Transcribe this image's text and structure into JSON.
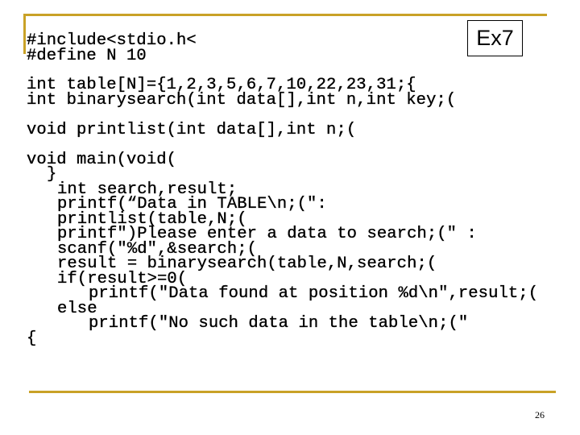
{
  "slide": {
    "label": "Ex7",
    "page_number": "26",
    "accent_color": "#c9a227",
    "code_lines": [
      "#include<stdio.h<",
      "#define N 10",
      "int table[N]={1,2,3,5,6,7,10,22,23,31;{",
      "int binarysearch(int data[],int n,int key;(",
      "void printlist(int data[],int n;(",
      "void main(void(",
      "}",
      "int search,result;",
      "printf(“Data in TABLE\\n;(\":",
      "printlist(table,N;(",
      "printf\")Please enter a data to search;(\" :",
      "scanf(\"%d\",&search;(",
      "result = binarysearch(table,N,search;(",
      "if(result>=0(",
      "printf(\"Data found at position %d\\n\",result;(",
      "else",
      "printf(\"No such data in the table\\n;(\"",
      "{"
    ]
  }
}
